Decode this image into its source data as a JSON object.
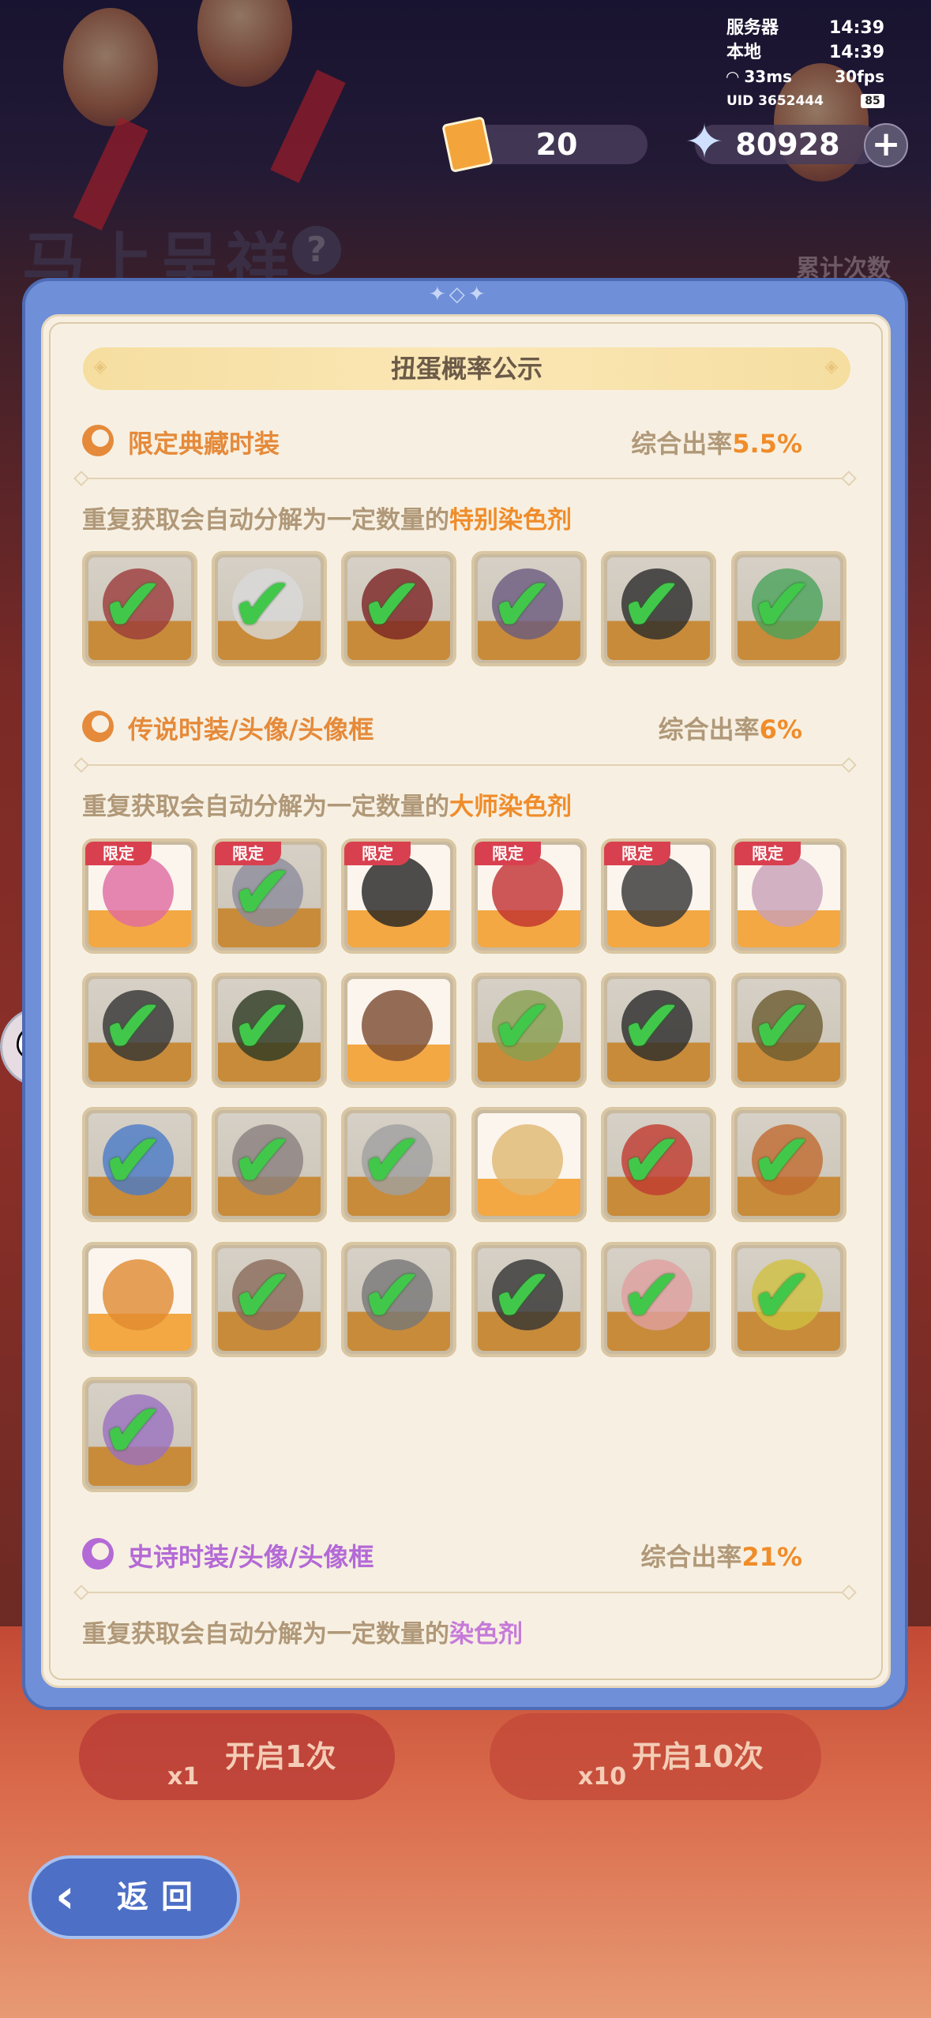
{
  "status": {
    "server_label": "服务器",
    "server_time": "14:39",
    "local_label": "本地",
    "local_time": "14:39",
    "ping": "33ms",
    "fps": "30fps",
    "uid": "UID 3652444",
    "battery": "85"
  },
  "currency": {
    "tickets": "20",
    "stars": "80928",
    "plus": "+"
  },
  "background": {
    "event_title": "马上呈祥",
    "help": "?",
    "counter_label": "累计次数"
  },
  "dialog": {
    "title": "扭蛋概率公示",
    "sections": [
      {
        "name": "限定典藏时装",
        "rate_label": "综合出率",
        "rate": "5.5%",
        "desc_prefix": "重复获取会自动分解为一定数量的",
        "desc_item": "特别染色剂",
        "color": "#e58a3a"
      },
      {
        "name": "传说时装/头像/头像框",
        "rate_label": "综合出率",
        "rate": "6%",
        "desc_prefix": "重复获取会自动分解为一定数量的",
        "desc_item": "大师染色剂",
        "color": "#e58a3a",
        "limited_badge": "限定"
      },
      {
        "name": "史诗时装/头像/头像框",
        "rate_label": "综合出率",
        "rate": "21%",
        "desc_prefix": "重复获取会自动分解为一定数量的",
        "desc_item": "染色剂",
        "color": "#b46ad6"
      }
    ]
  },
  "buttons": {
    "open_one": "开启1次",
    "open_one_mult": "x1",
    "open_ten": "开启10次",
    "open_ten_mult": "x10",
    "back": "返回"
  },
  "colors": {
    "accent_orange": "#f08c2a",
    "accent_purple": "#c67ad9",
    "check_green": "#41c84a",
    "badge_red": "#d9404f"
  }
}
